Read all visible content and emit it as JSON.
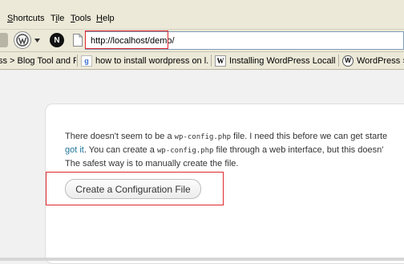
{
  "menu": [
    "Shortcuts",
    "Tile",
    "Tools",
    "Help"
  ],
  "address": {
    "url": "http://localhost/demo/"
  },
  "tabs": [
    {
      "label": "ss > Blog Tool and P..."
    },
    {
      "label": "how to install wordpress on l..."
    },
    {
      "label": "Installing WordPress Locally"
    },
    {
      "label": "WordPress › D"
    }
  ],
  "content": {
    "line1_a": "There doesn't seem to be a ",
    "line1_code": "wp-config.php",
    "line1_b": " file. I need this before we can get starte",
    "line2_link": "got it",
    "line2_a": ". You can create a ",
    "line2_code": "wp-config.php",
    "line2_b": " file through a web interface, but this doesn'",
    "line3": "The safest way is to manually create the file.",
    "button": "Create a Configuration File"
  },
  "colors": {
    "highlight": "#e0282e",
    "link": "#21759b"
  }
}
